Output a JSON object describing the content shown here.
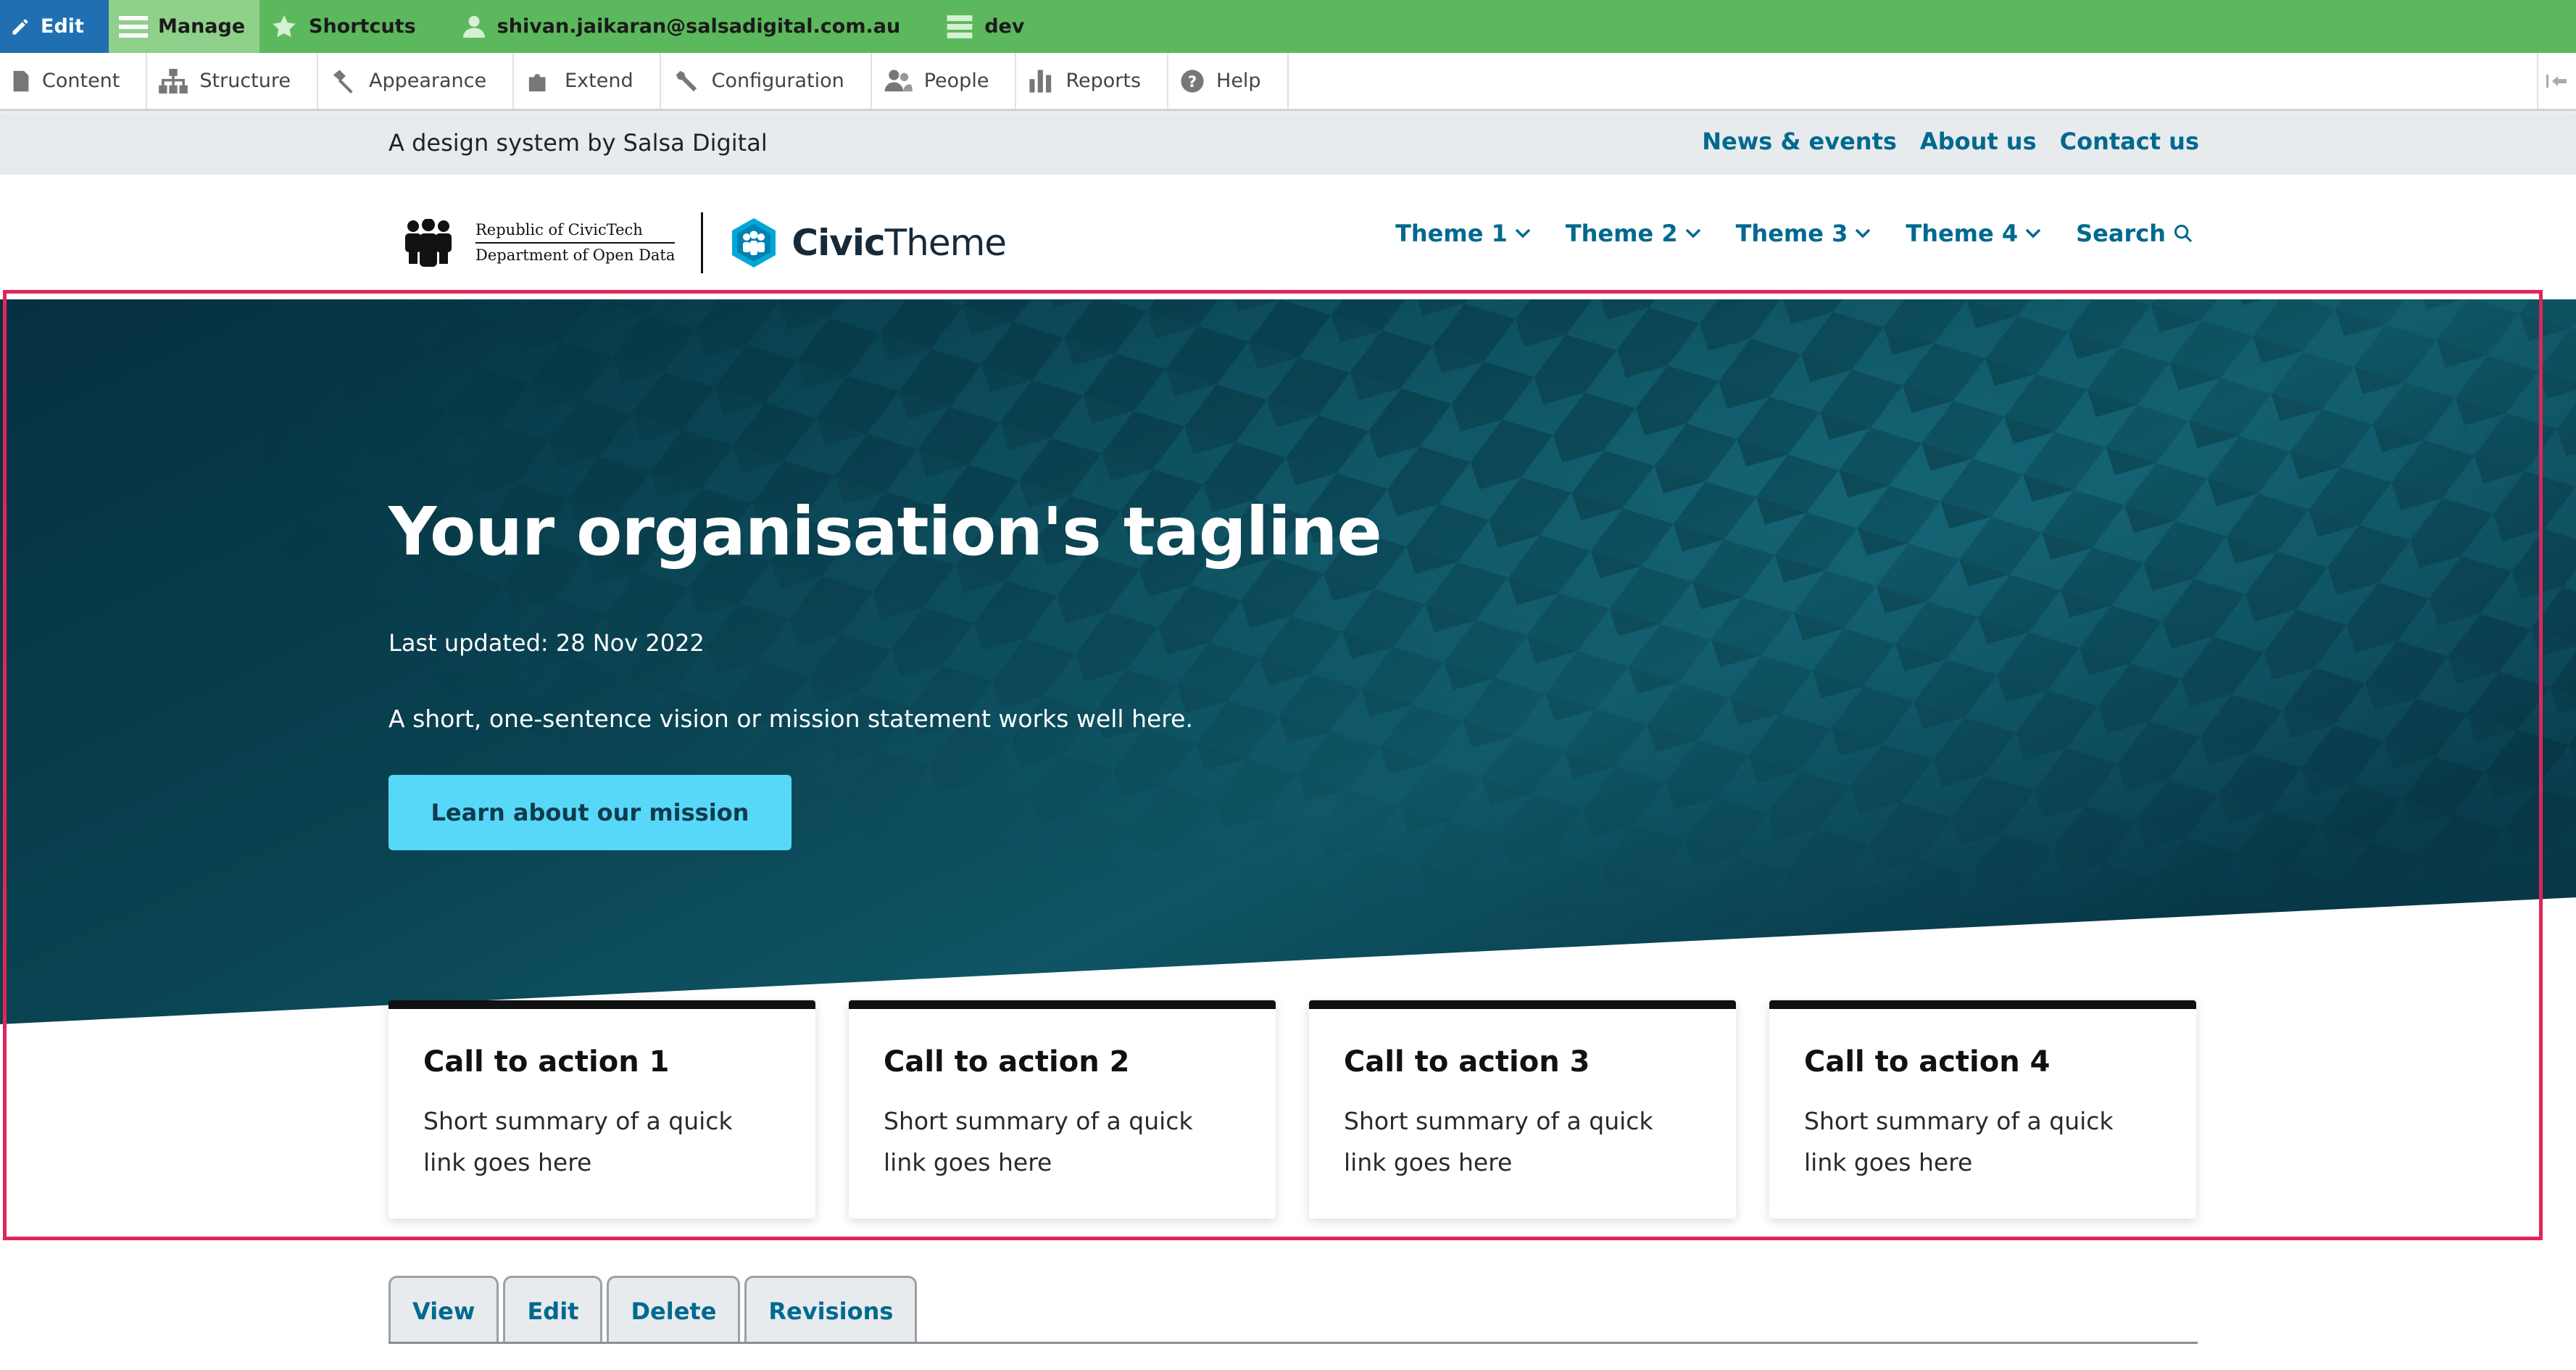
{
  "admin_toolbar": {
    "edit_label": "Edit",
    "manage_label": "Manage",
    "shortcuts_label": "Shortcuts",
    "user_label": "shivan.jaikaran@salsadigital.com.au",
    "environment_label": "dev",
    "tray_items": [
      {
        "label": "Content",
        "icon": "document-icon"
      },
      {
        "label": "Structure",
        "icon": "structure-icon"
      },
      {
        "label": "Appearance",
        "icon": "paint-brush-icon"
      },
      {
        "label": "Extend",
        "icon": "puzzle-icon"
      },
      {
        "label": "Configuration",
        "icon": "wrench-icon"
      },
      {
        "label": "People",
        "icon": "people-icon"
      },
      {
        "label": "Reports",
        "icon": "bar-chart-icon"
      },
      {
        "label": "Help",
        "icon": "help-icon"
      }
    ]
  },
  "header": {
    "tagline": "A design system by Salsa Digital",
    "secondary_nav": [
      "News & events",
      "About us",
      "Contact us"
    ],
    "gov_logo": {
      "line1": "Republic of CivicTech",
      "line2": "Department of Open Data"
    },
    "brand": {
      "bold": "Civic",
      "regular": "Theme"
    },
    "primary_nav": [
      "Theme 1",
      "Theme 2",
      "Theme 3",
      "Theme 4"
    ],
    "search_label": "Search"
  },
  "banner": {
    "title": "Your organisation's tagline",
    "last_updated": "Last updated: 28 Nov 2022",
    "summary": "A short, one-sentence vision or mission statement works well here.",
    "button_label": "Learn about our mission"
  },
  "cards": [
    {
      "title": "Call to action 1",
      "summary": "Short summary of a quick link goes here"
    },
    {
      "title": "Call to action 2",
      "summary": "Short summary of a quick link goes here"
    },
    {
      "title": "Call to action 3",
      "summary": "Short summary of a quick link goes here"
    },
    {
      "title": "Call to action 4",
      "summary": "Short summary of a quick link goes here"
    }
  ],
  "local_tasks": [
    "View",
    "Edit",
    "Delete",
    "Revisions"
  ],
  "colors": {
    "toolbar_green": "#5cb85c",
    "edit_blue": "#1f6fb2",
    "link_teal": "#00698f",
    "banner_dark": "#05303f",
    "button_cyan": "#58d8f8",
    "focus_outline": "#e2245a"
  }
}
